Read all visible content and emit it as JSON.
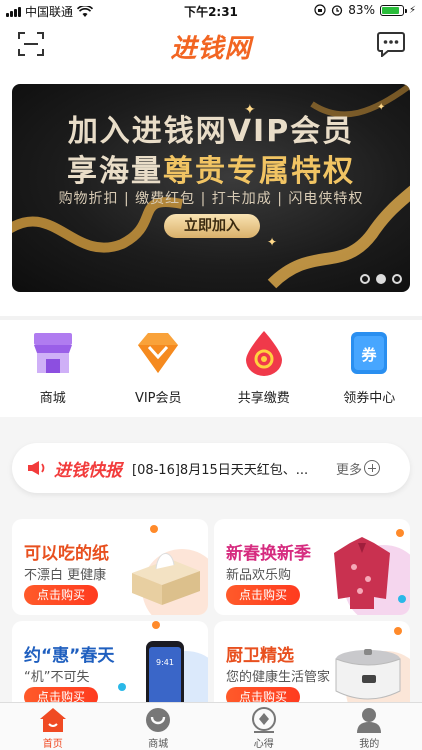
{
  "status_bar": {
    "carrier": "中国联通",
    "time": "下午2:31",
    "battery_percent": "83%",
    "battery_level": 0.83
  },
  "header": {
    "logo_text": "进钱网",
    "scan_icon": "scan-icon",
    "message_icon": "message-icon"
  },
  "banner": {
    "title_line1": "加入进钱网VIP会员",
    "title_line2_a": "享海量",
    "title_line2_b": "尊贵专属特权",
    "subtitle": "购物折扣 | 缴费红包 | 打卡加成 | 闪电侠特权",
    "button_label": "立即加入",
    "page_count": 3,
    "active_page": 2
  },
  "categories": [
    {
      "label": "商城",
      "icon": "store-icon"
    },
    {
      "label": "VIP会员",
      "icon": "vip-diamond-icon"
    },
    {
      "label": "共享缴费",
      "icon": "payment-drop-icon"
    },
    {
      "label": "领券中心",
      "icon": "coupon-icon"
    }
  ],
  "news": {
    "brand": "进钱快报",
    "text": "[08-16]8月15日天天红包、...",
    "more_label": "更多"
  },
  "cards": [
    {
      "title": "可以吃的纸",
      "subtitle": "不漂白 更健康",
      "button": "点击购买",
      "title_color": "#e8501f"
    },
    {
      "title": "新春换新季",
      "subtitle": "新品欢乐购",
      "button": "点击购买",
      "title_color": "#d62b7f"
    },
    {
      "title": "约“惠”春天",
      "subtitle": "“机”不可失",
      "button": "点击购买",
      "title_color": "#1f5fbf"
    },
    {
      "title": "厨卫精选",
      "subtitle": "您的健康生活管家",
      "button": "点击购买",
      "title_color": "#e8501f"
    }
  ],
  "tabs": [
    {
      "label": "首页",
      "icon": "home-icon",
      "active": true
    },
    {
      "label": "商城",
      "icon": "store-tab-icon",
      "active": false
    },
    {
      "label": "心得",
      "icon": "insight-icon",
      "active": false
    },
    {
      "label": "我的",
      "icon": "profile-icon",
      "active": false
    }
  ],
  "colors": {
    "brand": "#f26522",
    "accent_red": "#f04a23",
    "gold": "#f1c463"
  }
}
